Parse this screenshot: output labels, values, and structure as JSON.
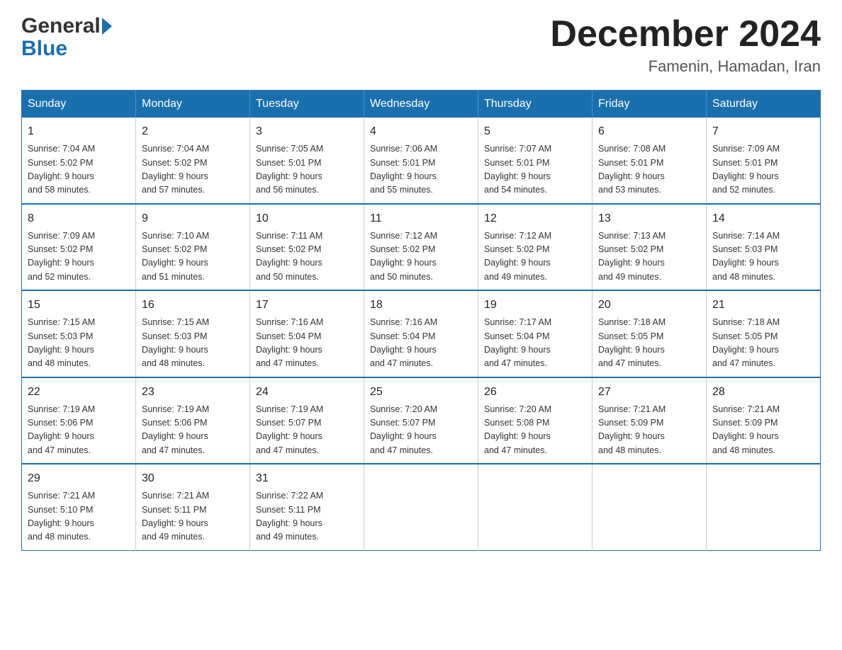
{
  "logo": {
    "general": "General",
    "blue": "Blue"
  },
  "header": {
    "month_year": "December 2024",
    "location": "Famenin, Hamadan, Iran"
  },
  "days_of_week": [
    "Sunday",
    "Monday",
    "Tuesday",
    "Wednesday",
    "Thursday",
    "Friday",
    "Saturday"
  ],
  "weeks": [
    [
      {
        "date": "1",
        "sunrise": "7:04 AM",
        "sunset": "5:02 PM",
        "daylight": "9 hours and 58 minutes."
      },
      {
        "date": "2",
        "sunrise": "7:04 AM",
        "sunset": "5:02 PM",
        "daylight": "9 hours and 57 minutes."
      },
      {
        "date": "3",
        "sunrise": "7:05 AM",
        "sunset": "5:01 PM",
        "daylight": "9 hours and 56 minutes."
      },
      {
        "date": "4",
        "sunrise": "7:06 AM",
        "sunset": "5:01 PM",
        "daylight": "9 hours and 55 minutes."
      },
      {
        "date": "5",
        "sunrise": "7:07 AM",
        "sunset": "5:01 PM",
        "daylight": "9 hours and 54 minutes."
      },
      {
        "date": "6",
        "sunrise": "7:08 AM",
        "sunset": "5:01 PM",
        "daylight": "9 hours and 53 minutes."
      },
      {
        "date": "7",
        "sunrise": "7:09 AM",
        "sunset": "5:01 PM",
        "daylight": "9 hours and 52 minutes."
      }
    ],
    [
      {
        "date": "8",
        "sunrise": "7:09 AM",
        "sunset": "5:02 PM",
        "daylight": "9 hours and 52 minutes."
      },
      {
        "date": "9",
        "sunrise": "7:10 AM",
        "sunset": "5:02 PM",
        "daylight": "9 hours and 51 minutes."
      },
      {
        "date": "10",
        "sunrise": "7:11 AM",
        "sunset": "5:02 PM",
        "daylight": "9 hours and 50 minutes."
      },
      {
        "date": "11",
        "sunrise": "7:12 AM",
        "sunset": "5:02 PM",
        "daylight": "9 hours and 50 minutes."
      },
      {
        "date": "12",
        "sunrise": "7:12 AM",
        "sunset": "5:02 PM",
        "daylight": "9 hours and 49 minutes."
      },
      {
        "date": "13",
        "sunrise": "7:13 AM",
        "sunset": "5:02 PM",
        "daylight": "9 hours and 49 minutes."
      },
      {
        "date": "14",
        "sunrise": "7:14 AM",
        "sunset": "5:03 PM",
        "daylight": "9 hours and 48 minutes."
      }
    ],
    [
      {
        "date": "15",
        "sunrise": "7:15 AM",
        "sunset": "5:03 PM",
        "daylight": "9 hours and 48 minutes."
      },
      {
        "date": "16",
        "sunrise": "7:15 AM",
        "sunset": "5:03 PM",
        "daylight": "9 hours and 48 minutes."
      },
      {
        "date": "17",
        "sunrise": "7:16 AM",
        "sunset": "5:04 PM",
        "daylight": "9 hours and 47 minutes."
      },
      {
        "date": "18",
        "sunrise": "7:16 AM",
        "sunset": "5:04 PM",
        "daylight": "9 hours and 47 minutes."
      },
      {
        "date": "19",
        "sunrise": "7:17 AM",
        "sunset": "5:04 PM",
        "daylight": "9 hours and 47 minutes."
      },
      {
        "date": "20",
        "sunrise": "7:18 AM",
        "sunset": "5:05 PM",
        "daylight": "9 hours and 47 minutes."
      },
      {
        "date": "21",
        "sunrise": "7:18 AM",
        "sunset": "5:05 PM",
        "daylight": "9 hours and 47 minutes."
      }
    ],
    [
      {
        "date": "22",
        "sunrise": "7:19 AM",
        "sunset": "5:06 PM",
        "daylight": "9 hours and 47 minutes."
      },
      {
        "date": "23",
        "sunrise": "7:19 AM",
        "sunset": "5:06 PM",
        "daylight": "9 hours and 47 minutes."
      },
      {
        "date": "24",
        "sunrise": "7:19 AM",
        "sunset": "5:07 PM",
        "daylight": "9 hours and 47 minutes."
      },
      {
        "date": "25",
        "sunrise": "7:20 AM",
        "sunset": "5:07 PM",
        "daylight": "9 hours and 47 minutes."
      },
      {
        "date": "26",
        "sunrise": "7:20 AM",
        "sunset": "5:08 PM",
        "daylight": "9 hours and 47 minutes."
      },
      {
        "date": "27",
        "sunrise": "7:21 AM",
        "sunset": "5:09 PM",
        "daylight": "9 hours and 48 minutes."
      },
      {
        "date": "28",
        "sunrise": "7:21 AM",
        "sunset": "5:09 PM",
        "daylight": "9 hours and 48 minutes."
      }
    ],
    [
      {
        "date": "29",
        "sunrise": "7:21 AM",
        "sunset": "5:10 PM",
        "daylight": "9 hours and 48 minutes."
      },
      {
        "date": "30",
        "sunrise": "7:21 AM",
        "sunset": "5:11 PM",
        "daylight": "9 hours and 49 minutes."
      },
      {
        "date": "31",
        "sunrise": "7:22 AM",
        "sunset": "5:11 PM",
        "daylight": "9 hours and 49 minutes."
      },
      null,
      null,
      null,
      null
    ]
  ],
  "labels": {
    "sunrise": "Sunrise:",
    "sunset": "Sunset:",
    "daylight": "Daylight:"
  }
}
